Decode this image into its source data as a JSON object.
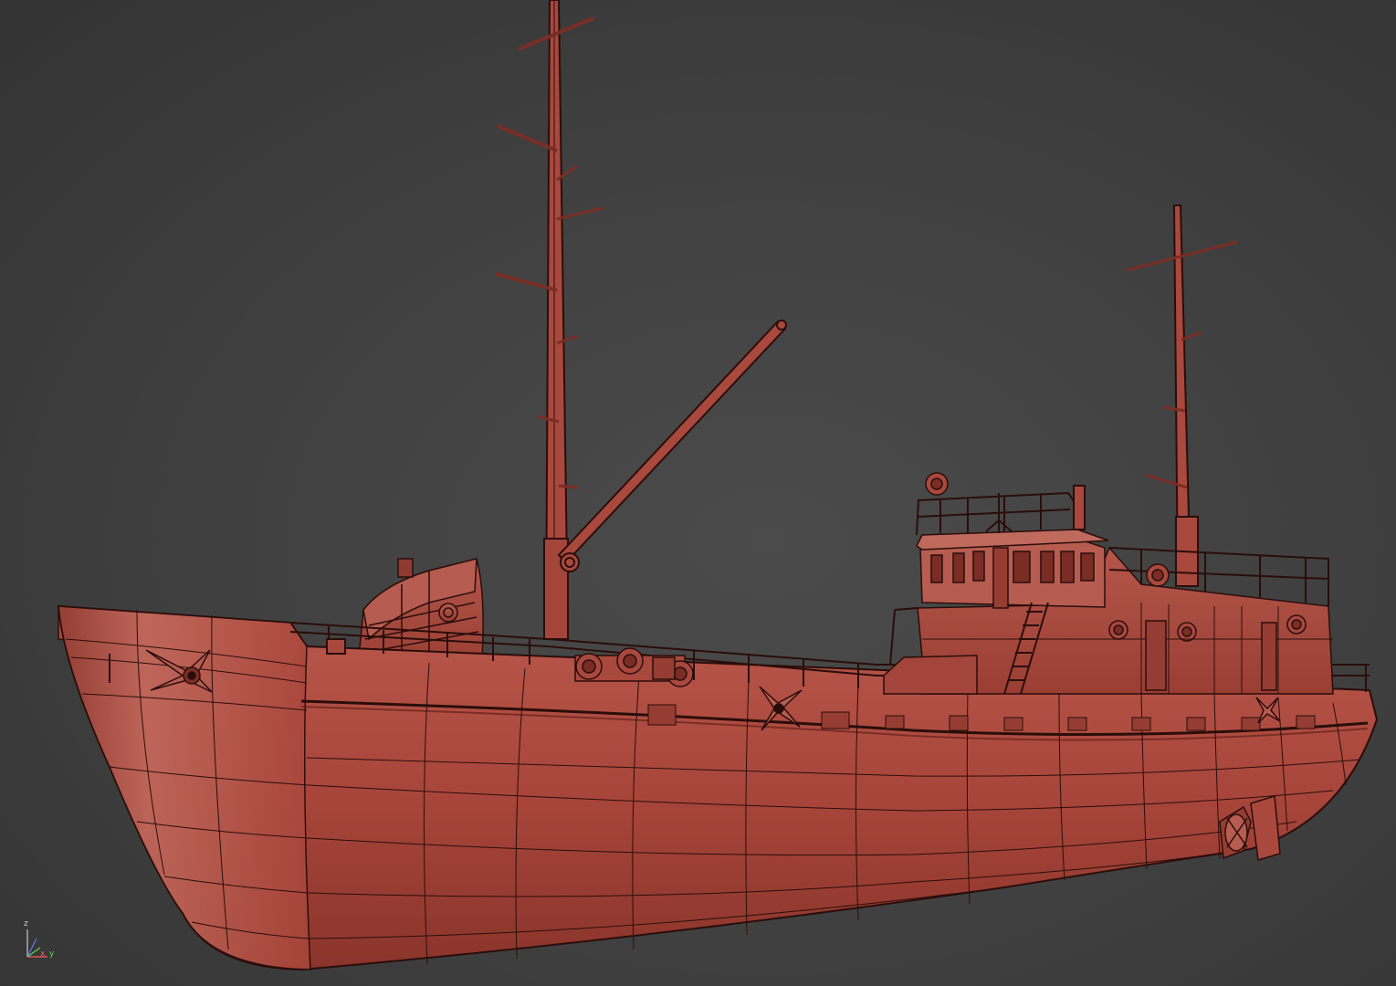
{
  "viewport": {
    "name": "perspective-viewport",
    "background": "#3f3f3f",
    "model_color": "#a9483d",
    "wire_color": "#2a0d0a"
  },
  "axis_tripod": {
    "z_label": "z",
    "x_label": "x",
    "y_label": "y",
    "x_color": "#ff5a5a",
    "y_color": "#5adc5a",
    "z_color": "#c8c8c8"
  }
}
